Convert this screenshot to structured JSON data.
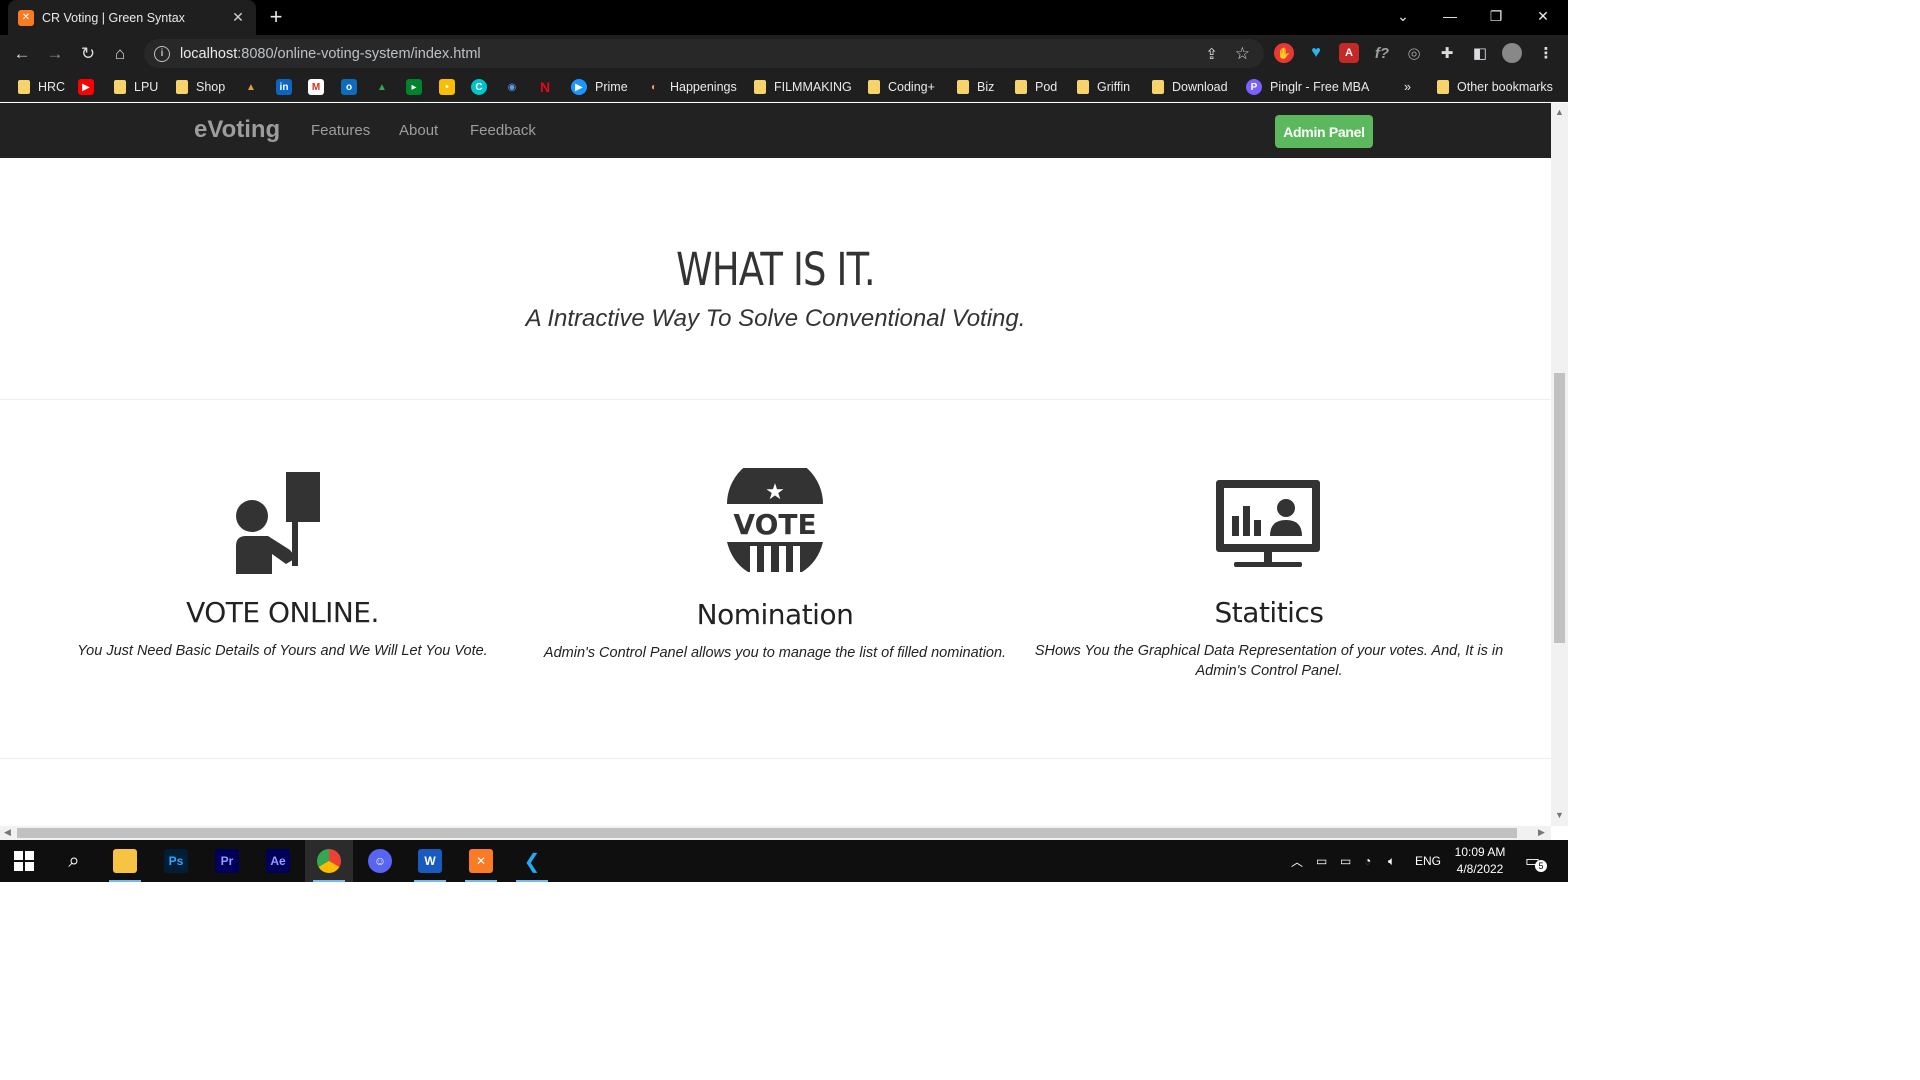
{
  "browser": {
    "tab_title": "CR Voting | Green Syntax",
    "tab_favicon": "xampp-icon",
    "url_host": "localhost",
    "url_rest": ":8080/online-voting-system/index.html"
  },
  "bookmarks": {
    "items": [
      {
        "label": "HRC",
        "icon": "folder"
      },
      {
        "label": "",
        "icon": "youtube"
      },
      {
        "label": "LPU",
        "icon": "folder"
      },
      {
        "label": "Shop",
        "icon": "folder"
      },
      {
        "label": "",
        "icon": "triangle"
      },
      {
        "label": "",
        "icon": "linkedin"
      },
      {
        "label": "",
        "icon": "gmail"
      },
      {
        "label": "",
        "icon": "outlook"
      },
      {
        "label": "",
        "icon": "drive"
      },
      {
        "label": "",
        "icon": "meet"
      },
      {
        "label": "",
        "icon": "keep"
      },
      {
        "label": "",
        "icon": "canva"
      },
      {
        "label": "",
        "icon": "radar"
      },
      {
        "label": "",
        "icon": "netflix"
      },
      {
        "label": "Prime",
        "icon": "prime"
      },
      {
        "label": "Happenings",
        "icon": "happenings"
      },
      {
        "label": "FILMMAKING",
        "icon": "folder"
      },
      {
        "label": "Coding+",
        "icon": "folder"
      },
      {
        "label": "Biz",
        "icon": "folder"
      },
      {
        "label": "Pod",
        "icon": "folder"
      },
      {
        "label": "Griffin",
        "icon": "folder"
      },
      {
        "label": "Download",
        "icon": "folder"
      },
      {
        "label": "Pinglr - Free MBA",
        "icon": "pinglr"
      }
    ],
    "overflow": "»",
    "other": "Other bookmarks"
  },
  "nav": {
    "brand": "eVoting",
    "links": [
      "Features",
      "About",
      "Feedback"
    ],
    "admin_button": "Admin Panel"
  },
  "hero": {
    "title": "WHAT IS IT.",
    "subtitle": "A Intractive Way To Solve Conventional Voting."
  },
  "features": [
    {
      "title": "VOTE ONLINE.",
      "text": "You Just Need Basic Details of Yours and We Will Let You Vote.",
      "icon": "voter-sign-icon"
    },
    {
      "title": "Nomination",
      "text": "Admin's Control Panel allows you to manage the list of filled nomination.",
      "icon": "vote-badge-icon"
    },
    {
      "title": "Statitics",
      "text": "SHows You the Graphical Data Representation of your votes. And, It is in Admin's Control Panel.",
      "icon": "stats-monitor-icon"
    }
  ],
  "taskbar": {
    "apps": [
      "windows-start",
      "search",
      "file-explorer",
      "photoshop",
      "premiere-pro",
      "after-effects",
      "chrome",
      "discord",
      "word",
      "xampp",
      "vscode"
    ],
    "language": "ENG",
    "time": "10:09 AM",
    "date": "4/8/2022",
    "notifications": "5"
  },
  "colors": {
    "navbar": "#222222",
    "admin_button": "#5cb85c",
    "brand_text": "#9d9d9d"
  }
}
